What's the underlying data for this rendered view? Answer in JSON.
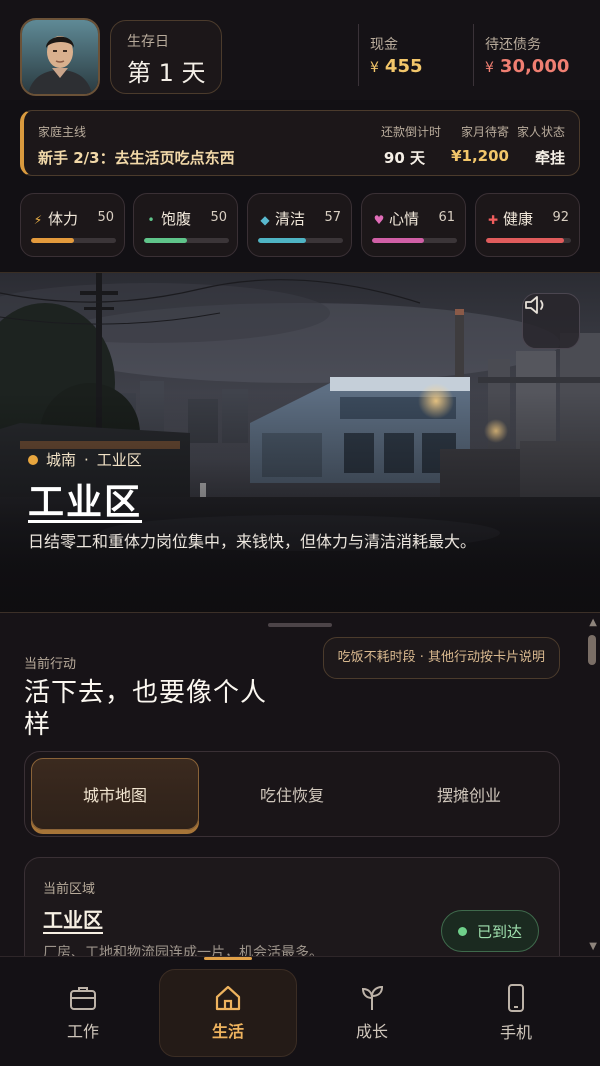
{
  "status": {
    "survival_day_label": "生存日",
    "survival_day_value": "第 1 天",
    "cash_label": "现金",
    "cash_currency": "¥",
    "cash_value": "455",
    "debt_label": "待还债务",
    "debt_currency": "¥",
    "debt_value": "30,000"
  },
  "main_quest": {
    "label": "家庭主线",
    "text": "新手 2/3：去生活页吃点东西",
    "countdown_label": "还款倒计时",
    "countdown_value": "90 天",
    "monthly_label": "家月待寄",
    "monthly_value": "¥1,200",
    "family_label": "家人状态",
    "family_value": "牵挂"
  },
  "stats": [
    {
      "label": "体力",
      "value": "50",
      "icon": "bolt-icon",
      "percent": 50,
      "color": "#e39a3c",
      "icon_color": "#f0b347"
    },
    {
      "label": "饱腹",
      "value": "50",
      "icon": "dot-icon",
      "percent": 50,
      "color": "#5fc48a",
      "icon_color": "#5fc48a"
    },
    {
      "label": "清洁",
      "value": "57",
      "icon": "drop-icon",
      "percent": 57,
      "color": "#4fb4c4",
      "icon_color": "#59b9cf"
    },
    {
      "label": "心情",
      "value": "61",
      "icon": "heart-icon",
      "percent": 61,
      "color": "#d05fa6",
      "icon_color": "#e06db8"
    },
    {
      "label": "健康",
      "value": "92",
      "icon": "plus-icon",
      "percent": 92,
      "color": "#e05c5c",
      "icon_color": "#ef5d5d"
    }
  ],
  "location": {
    "district": "城南",
    "zone": "工业区",
    "title": "工业区",
    "description": "日结零工和重体力岗位集中，来钱快，但体力与清洁消耗最大。"
  },
  "actions": {
    "section_label": "当前行动",
    "title": "活下去，也要像个人样",
    "hint": "吃饭不耗时段 · 其他行动按卡片说明",
    "tabs": [
      "城市地图",
      "吃住恢复",
      "摆摊创业"
    ]
  },
  "area_card": {
    "label": "当前区域",
    "name": "工业区",
    "description": "厂房、工地和物流园连成一片，机会活最多。",
    "status": "已到达"
  },
  "nav": [
    "工作",
    "生活",
    "成长",
    "手机"
  ],
  "colors": {
    "accent": "#e0a048",
    "cash": "#f2c66a",
    "debt": "#f07f72",
    "success": "#6fd08a"
  }
}
